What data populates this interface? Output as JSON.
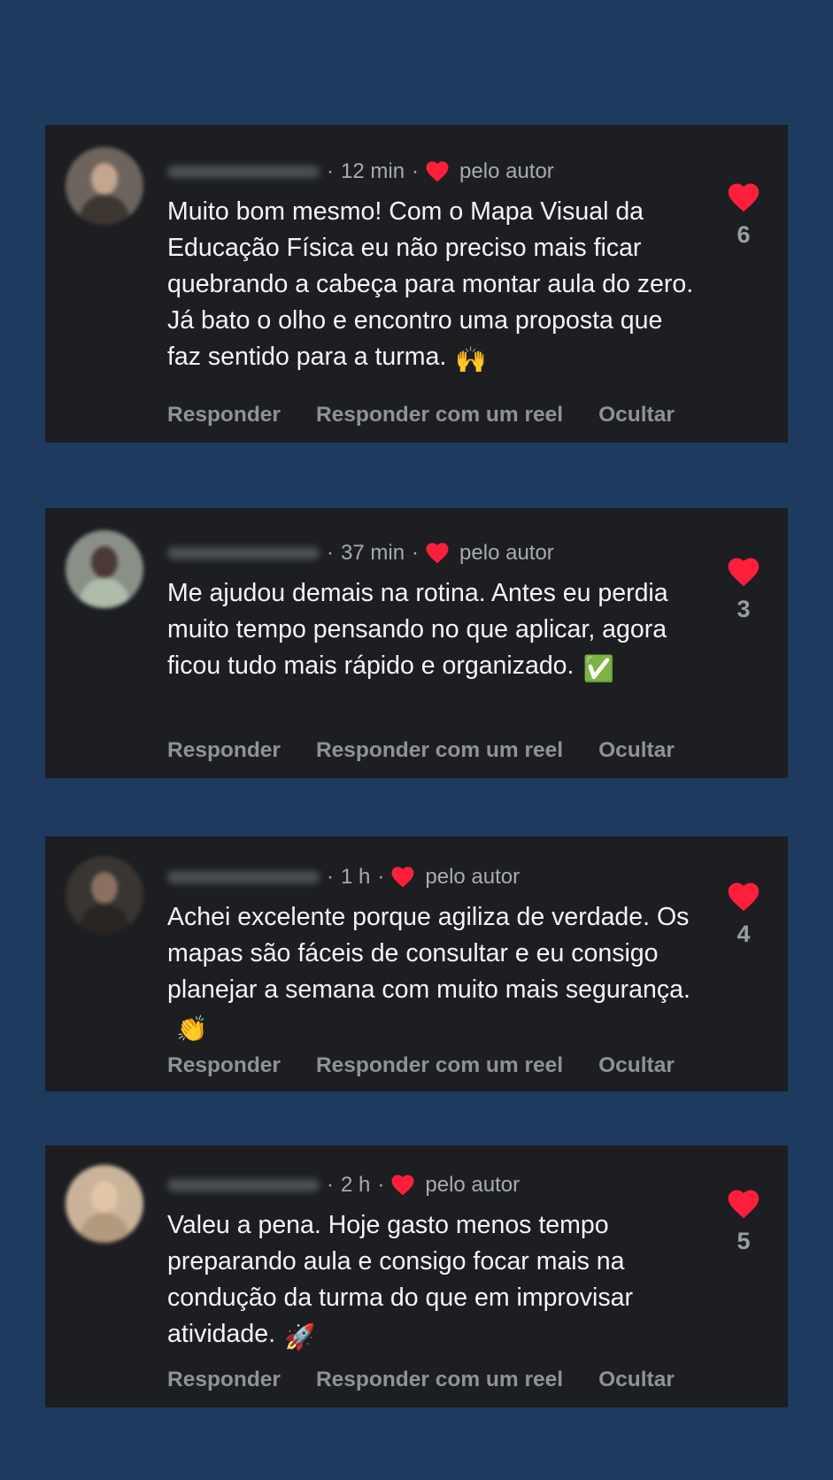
{
  "colors": {
    "background": "#1f3a5f",
    "card": "#1c1e22",
    "heart": "#ff1f3d",
    "text": "#f4f5f6",
    "muted": "#8f9297"
  },
  "comments": [
    {
      "time": "12 min",
      "author_badge": "pelo autor",
      "text": "Muito bom mesmo! Com o Mapa Visual da Educação Física eu não preciso mais ficar quebrando a cabeça para montar aula do zero. Já bato o olho e encontro uma proposta que faz sentido para a turma.",
      "emoji": "🙌",
      "likes": "6",
      "actions": {
        "reply": "Responder",
        "reply_reel": "Responder com um reel",
        "hide": "Ocultar"
      }
    },
    {
      "time": "37 min",
      "author_badge": "pelo autor",
      "text": "Me ajudou demais na rotina. Antes eu perdia muito tempo pensando no que aplicar, agora ficou tudo mais rápido e organizado.",
      "emoji": "✅",
      "likes": "3",
      "actions": {
        "reply": "Responder",
        "reply_reel": "Responder com um reel",
        "hide": "Ocultar"
      }
    },
    {
      "time": "1 h",
      "author_badge": "pelo autor",
      "text": "Achei excelente porque agiliza de verdade. Os mapas são fáceis de consultar e eu consigo planejar a semana com muito mais segurança.",
      "emoji": "👏",
      "likes": "4",
      "actions": {
        "reply": "Responder",
        "reply_reel": "Responder com um reel",
        "hide": "Ocultar"
      }
    },
    {
      "time": "2 h",
      "author_badge": "pelo autor",
      "text": "Valeu a pena. Hoje gasto menos tempo preparando aula e consigo focar mais na condução da turma do que em improvisar atividade.",
      "emoji": "🚀",
      "likes": "5",
      "actions": {
        "reply": "Responder",
        "reply_reel": "Responder com um reel",
        "hide": "Ocultar"
      }
    }
  ]
}
